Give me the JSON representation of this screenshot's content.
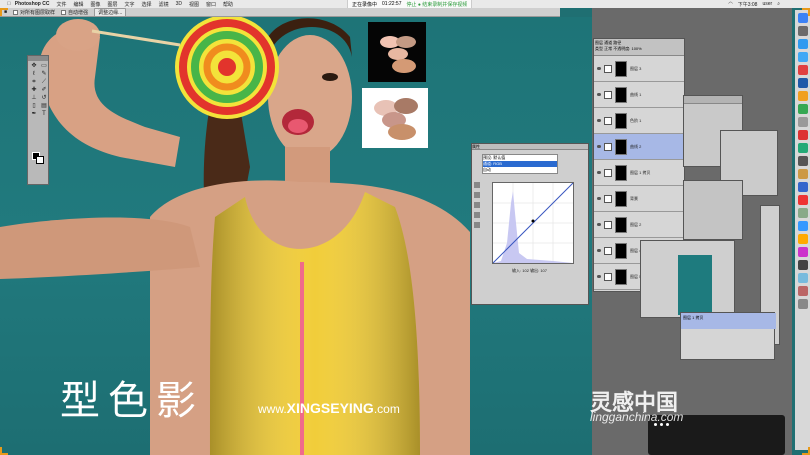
{
  "menubar": {
    "app_name": "Photoshop CC",
    "items": [
      "文件",
      "编辑",
      "图像",
      "图层",
      "文字",
      "选择",
      "滤镜",
      "3D",
      "视图",
      "窗口",
      "帮助"
    ],
    "recording_label": "正在录像中",
    "recording_time": "01:22:57",
    "recording_stop": "停止 ● 结束录制并保存视频",
    "clock": "下午3:08",
    "user": "user"
  },
  "options_bar": {
    "tool_label": "■",
    "check1_label": "对所有图层取样",
    "check2_label": "自动增强",
    "button_label": "调整边缘..."
  },
  "curves": {
    "title": "属性",
    "preset_rows": [
      "预设: 默认值",
      "通道: RGB",
      "自动"
    ],
    "input_label": "输入:",
    "input_value": "102",
    "output_label": "输出:",
    "output_value": "107"
  },
  "layers": {
    "tabs": [
      "图层",
      "通道",
      "路径"
    ],
    "kind_label": "类型",
    "mode_label": "正常",
    "opacity_label": "不透明度: 100%",
    "rows": [
      {
        "name": "图层 3"
      },
      {
        "name": "曲线 1"
      },
      {
        "name": "色阶 1"
      },
      {
        "name": "曲线 2"
      },
      {
        "name": "图层 1 拷贝"
      },
      {
        "name": "背景"
      },
      {
        "name": "图层 2"
      },
      {
        "name": "图层 4"
      },
      {
        "name": "图层 5"
      }
    ]
  },
  "panel_e": {
    "selected_label": "图层 1 拷贝"
  },
  "overlay": {
    "brand_cn": "型色影",
    "site_prefix": "www.",
    "site_main": "XINGSEYING",
    "site_suffix": ".com",
    "watermark_cn": "灵感中国",
    "watermark_en": "lingganchina.com"
  },
  "colors": {
    "background_teal": "#1f6f72",
    "dress_yellow": "#f1cd3a",
    "zipper_pink": "#f06a8a",
    "selection_blue": "#a7b8e6"
  }
}
